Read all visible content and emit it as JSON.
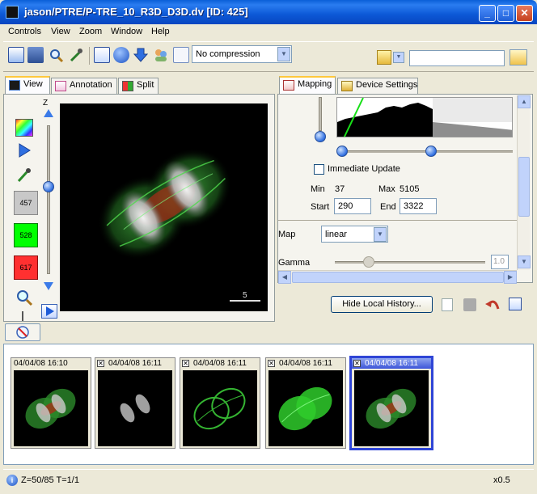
{
  "window": {
    "title": "jason/PTRE/P-TRE_10_R3D_D3D.dv [ID: 425]",
    "minimize_glyph": "_",
    "maximize_glyph": "□",
    "close_glyph": "✕"
  },
  "menubar": {
    "items": [
      "Controls",
      "View",
      "Zoom",
      "Window",
      "Help"
    ]
  },
  "toolbar": {
    "compression_value": "No compression",
    "search_value": ""
  },
  "left_tabs": [
    "View",
    "Annotation",
    "Split"
  ],
  "left_panel": {
    "z_label": "Z",
    "channels": [
      {
        "label": "457",
        "color": "#c8c8c8"
      },
      {
        "label": "528",
        "color": "#00ff00"
      },
      {
        "label": "617",
        "color": "#ff3030"
      }
    ],
    "scale_label": "5"
  },
  "right_tabs": [
    "Mapping",
    "Device Settings"
  ],
  "mapping": {
    "immediate_update_label": "Immediate Update",
    "immediate_update_checked": false,
    "min_label": "Min",
    "min_value": "37",
    "max_label": "Max",
    "max_value": "5105",
    "start_label": "Start",
    "start_value": "290",
    "end_label": "End",
    "end_value": "3322",
    "map_label": "Map",
    "map_value": "linear",
    "gamma_label": "Gamma",
    "gamma_value": "1.0"
  },
  "hide_history_label": "Hide Local History...",
  "history": {
    "items": [
      {
        "timestamp": "04/04/08 16:10",
        "closable": false,
        "selected": false
      },
      {
        "timestamp": "04/04/08 16:11",
        "closable": true,
        "selected": false
      },
      {
        "timestamp": "04/04/08 16:11",
        "closable": true,
        "selected": false
      },
      {
        "timestamp": "04/04/08 16:11",
        "closable": true,
        "selected": false
      },
      {
        "timestamp": "04/04/08 16:11",
        "closable": true,
        "selected": true
      }
    ]
  },
  "status": {
    "left": "Z=50/85 T=1/1",
    "right": "x0.5"
  }
}
